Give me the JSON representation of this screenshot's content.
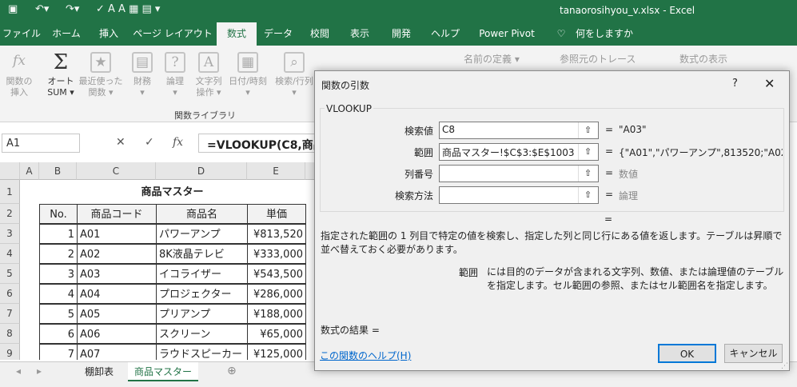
{
  "titlebar": {
    "filename": "tanaorosihyou_v.xlsx",
    "app": "Excel",
    "title": "tanaorosihyou_v.xlsx  -  Excel",
    "save_icon": "save-icon",
    "undo_icon": "undo-icon",
    "redo_icon": "redo-icon"
  },
  "tabs": [
    "ファイル",
    "ホーム",
    "挿入",
    "ページ レイアウト",
    "数式",
    "データ",
    "校閲",
    "表示",
    "開発",
    "ヘルプ",
    "Power Pivot",
    "何をしますか"
  ],
  "ribbon": {
    "buttons": [
      {
        "label1": "関数の",
        "label2": "挿入",
        "icon": "fx"
      },
      {
        "label1": "オート",
        "label2": "SUM ▾",
        "icon": "Σ"
      },
      {
        "label1": "最近使った",
        "label2": "関数 ▾",
        "icon": "★"
      },
      {
        "label1": "財務",
        "label2": "▾",
        "icon": "▤"
      },
      {
        "label1": "論理",
        "label2": "▾",
        "icon": "?"
      },
      {
        "label1": "文字列",
        "label2": "操作 ▾",
        "icon": "A"
      },
      {
        "label1": "日付/時刻",
        "label2": "▾",
        "icon": "▦"
      },
      {
        "label1": "検索/行列",
        "label2": "▾",
        "icon": "⌕"
      }
    ],
    "group_label": "関数ライブラリ",
    "name_define": "名前の定義 ▾",
    "trace": "参照元のトレース",
    "show_formulas": "数式の表示"
  },
  "formulabar": {
    "namebox": "A1",
    "formula": "=VLOOKUP(C8,商品"
  },
  "sheet": {
    "columns": [
      "A",
      "B",
      "C",
      "D",
      "E"
    ],
    "rows": [
      "1",
      "2",
      "3",
      "4",
      "5",
      "6",
      "7",
      "8",
      "9"
    ],
    "title": "商品マスター",
    "headers": [
      "No.",
      "商品コード",
      "商品名",
      "単価"
    ],
    "data": [
      [
        "1",
        "A01",
        "パワーアンプ",
        "¥813,520"
      ],
      [
        "2",
        "A02",
        "8K液晶テレビ",
        "¥333,000"
      ],
      [
        "3",
        "A03",
        "イコライザー",
        "¥543,500"
      ],
      [
        "4",
        "A04",
        "プロジェクター",
        "¥286,000"
      ],
      [
        "5",
        "A05",
        "プリアンプ",
        "¥188,000"
      ],
      [
        "6",
        "A06",
        "スクリーン",
        "¥65,000"
      ],
      [
        "7",
        "A07",
        "ラウドスピーカー",
        "¥125,000"
      ]
    ]
  },
  "sheettabs": [
    "棚卸表",
    "商品マスター"
  ],
  "dialog": {
    "title": "関数の引数",
    "help": "?",
    "close": "✕",
    "function": "VLOOKUP",
    "args": [
      {
        "label": "検索値",
        "value": "C8",
        "result": "\"A03\""
      },
      {
        "label": "範囲",
        "value": "商品マスター!$C$3:$E$1003",
        "result": "{\"A01\",\"パワーアンプ\",813520;\"A02\",\"8"
      },
      {
        "label": "列番号",
        "value": "",
        "result": "数値"
      },
      {
        "label": "検索方法",
        "value": "",
        "result": "論理"
      }
    ],
    "eq": "=",
    "description": "指定された範囲の 1 列目で特定の値を検索し、指定した列と同じ行にある値を返します。テーブルは昇順で並べ替えておく必要があります。",
    "arg_name": "範囲",
    "arg_description": "には目的のデータが含まれる文字列、数値、または論理値のテーブルを指定します。セル範囲の参照、またはセル範囲名を指定します。",
    "result_label": "数式の結果 =",
    "help_link": "この関数のヘルプ(H)",
    "ok": "OK",
    "cancel": "キャンセル"
  }
}
